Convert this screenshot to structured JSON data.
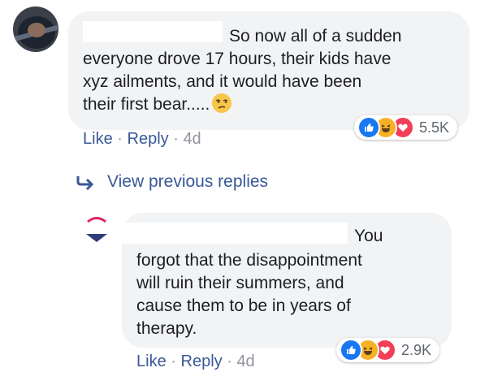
{
  "comment": {
    "text_lines": [
      "So now all of a sudden",
      "everyone drove 17 hours, their kids have",
      "xyz ailments, and it would have been",
      "their first bear....."
    ],
    "emoji": "unamused-face-icon",
    "reaction_count": "5.5K",
    "actions": {
      "like": "Like",
      "sep1": "·",
      "reply": "Reply",
      "sep2": "·",
      "time": "4d"
    }
  },
  "view_previous_replies": "View previous replies",
  "reply": {
    "text_lines": [
      "You",
      "forgot that the disappointment",
      "will ruin their summers, and",
      "cause them to be in years of",
      "therapy."
    ],
    "reaction_count": "2.9K",
    "actions": {
      "like": "Like",
      "sep1": "·",
      "reply": "Reply",
      "sep2": "·",
      "time": "4d"
    }
  },
  "colors": {
    "bubble": "#f2f3f5",
    "link": "#385898",
    "meta": "#90949c",
    "like": "#1877f2",
    "haha": "#f7b125",
    "love": "#f33e58"
  }
}
